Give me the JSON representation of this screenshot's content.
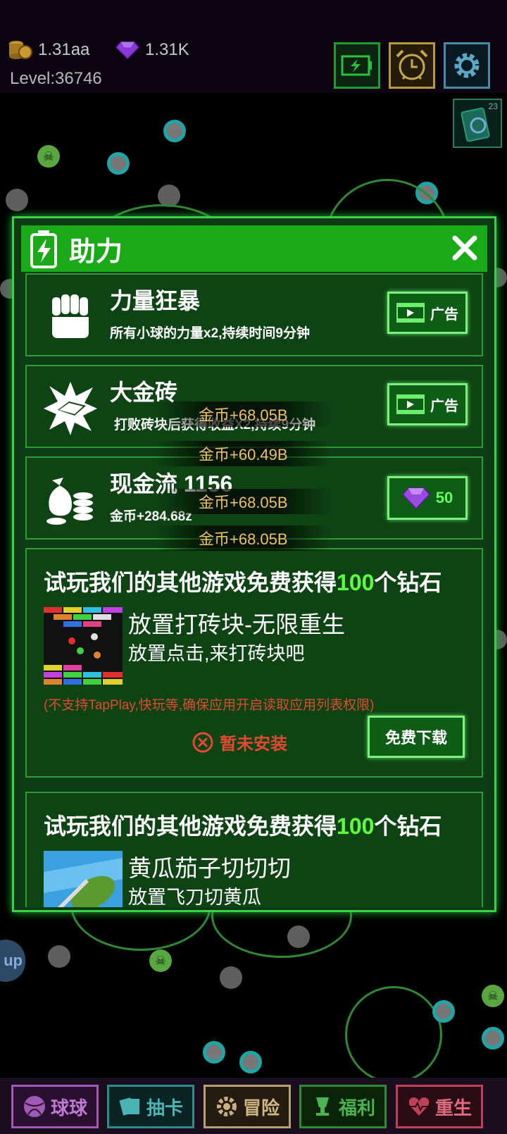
{
  "hud": {
    "coins": "1.31aa",
    "gems": "1.31K",
    "level": "Level:36746",
    "card_count": "23"
  },
  "panel": {
    "title": "助力",
    "boosts": [
      {
        "title": "力量狂暴",
        "desc": "所有小球的力量x2,持续时间9分钟",
        "button": "广告"
      },
      {
        "title": "大金砖",
        "desc": "打败砖块后获得收益X2,持续9分钟",
        "button": "广告"
      },
      {
        "title": "现金流 1156",
        "desc": "金币+284.68z",
        "button": "50"
      }
    ],
    "promos": [
      {
        "head_prefix": "试玩我们的其他游戏免费获得",
        "head_amount": "100",
        "head_suffix": "个钻石",
        "name": "放置打砖块-无限重生",
        "desc": "放置点击,来打砖块吧",
        "note": "(不支持TapPlay,快玩等,确保应用开启读取应用列表权限)",
        "status": "暂未安装",
        "download": "免费下载"
      },
      {
        "head_prefix": "试玩我们的其他游戏免费获得",
        "head_amount": "100",
        "head_suffix": "个钻石",
        "name": "黄瓜茄子切切切",
        "desc": "放置飞刀切黄瓜"
      }
    ]
  },
  "floats": [
    "金币+68.05B",
    "金币+60.49B",
    "金币+68.05B",
    "金币+68.05B"
  ],
  "side_tab": "up",
  "nav": [
    {
      "label": "球球",
      "color": "#a05ab4"
    },
    {
      "label": "抽卡",
      "color": "#2f8a8a"
    },
    {
      "label": "冒险",
      "color": "#b8a070"
    },
    {
      "label": "福利",
      "color": "#2f8a33"
    },
    {
      "label": "重生",
      "color": "#c0405a"
    }
  ],
  "colors": {
    "panel_green": "#1aaa18",
    "highlight_green": "#5bff3c",
    "warning_red": "#e04a30",
    "float_gold": "#f0c060"
  }
}
